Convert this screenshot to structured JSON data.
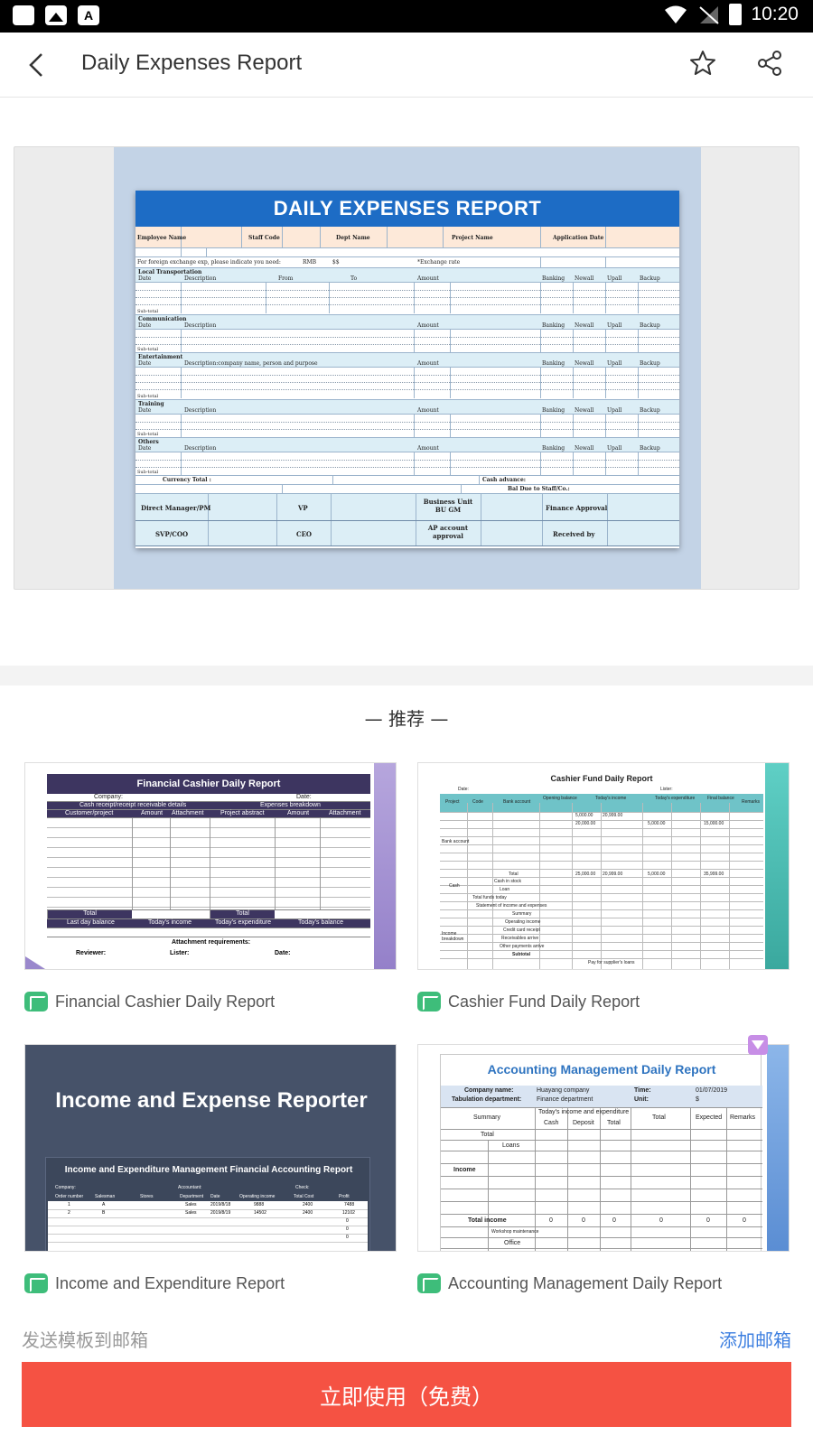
{
  "status_bar": {
    "time": "10:20"
  },
  "app_bar": {
    "title": "Daily Expenses Report"
  },
  "preview": {
    "doc_title": "DAILY EXPENSES REPORT",
    "header_fields": [
      "Employee Name",
      "Staff Code",
      "Dept Name",
      "Project Name",
      "Application Date"
    ],
    "exchange_note": "For foreign exchange exp, please indicate you need:",
    "rmb": "RMB",
    "usd": "$$",
    "exchange_rate": "*Exchange rate",
    "sections": [
      "Local Transportation",
      "Communication",
      "Entertainment",
      "Training",
      "Others"
    ],
    "col_date": "Date",
    "col_desc": "Description",
    "col_desc_ent": "Description:company name, person and purpose",
    "col_from": "From",
    "col_to": "To",
    "col_amount": "Amount",
    "col_banking": "Banking",
    "col_newall": "Newall",
    "col_upall": "Upall",
    "col_backup": "Backup",
    "subtotal": "Sub-total",
    "currency_total": "Currency Total :",
    "cash_advance": "Cash advance:",
    "bal_due": "Bal Due to Staff/Co.:",
    "approvals": [
      "Direct Manager/PM",
      "VP",
      "Business Unit BU GM",
      "Finance Approval",
      "SVP/COO",
      "CEO",
      "AP account approval",
      "Received by"
    ]
  },
  "recommend": {
    "heading": "— 推荐 —",
    "cards": [
      {
        "label": "Financial Cashier Daily Report"
      },
      {
        "label": "Cashier Fund Daily Report"
      },
      {
        "label": "Income and Expenditure Report"
      },
      {
        "label": "Accounting Management Daily Report"
      }
    ]
  },
  "thumb1": {
    "title": "Financial Cashier Daily Report",
    "company": "Company:",
    "date": "Date:",
    "receipt": "Cash receipt/receipt receivable details",
    "breakdown": "Expenses breakdown",
    "cols": [
      "Customer/project",
      "Amount",
      "Attachment",
      "Project abstract",
      "Amount",
      "Attachment"
    ],
    "total": "Total",
    "total2": "Total",
    "balances": [
      "Last day balance",
      "Today's income",
      "Today's expenditure",
      "Today's balance"
    ],
    "attach_req": "Attachment requirements:",
    "reviewer": "Reviewer:",
    "lister": "Lister:",
    "date2": "Date:"
  },
  "thumb2": {
    "title": "Cashier Fund Daily Report",
    "date": "Date:",
    "lister": "Lister:",
    "cols": [
      "Project",
      "Code",
      "Bank account",
      "Opening balance",
      "Today's income",
      "Today's expenditure",
      "Final balance",
      "Remarks"
    ],
    "rows": [
      "Bank account",
      "Total",
      "Cash",
      "Cash in stock",
      "Loan",
      "Total funds today",
      "Statement of income and expenses",
      "Summary",
      "Operating income",
      "Credit card receipt",
      "Receivables arrive",
      "Other payments arrive",
      "Income breakdown",
      "Subtotal",
      "Pay for supplier's loans"
    ],
    "values": [
      "5,000.00",
      "20,999.00",
      "20,000.00",
      "5,000.00",
      "15,000.00",
      "25,000.00",
      "20,999.00",
      "5,000.00",
      "35,999.00"
    ]
  },
  "thumb3": {
    "title": "Income and Expense Reporter",
    "box_title": "Income and Expenditure Management Financial Accounting Report",
    "company": "Company:",
    "accountant": "Accountant:",
    "check": "Check:",
    "cols": [
      "Order number",
      "Salesman",
      "Stores",
      "Department",
      "Date",
      "Operating income",
      "Total Cost",
      "Profit"
    ],
    "rows": [
      [
        "1",
        "A",
        "",
        "Sales",
        "2019/8/18",
        "9888",
        "2400",
        "7488"
      ],
      [
        "2",
        "B",
        "",
        "Sales",
        "2019/8/19",
        "14502",
        "2400",
        "12102"
      ]
    ],
    "zeros": [
      "0",
      "0",
      "0"
    ]
  },
  "thumb4": {
    "title": "Accounting Management Daily Report",
    "company_name": "Company name:",
    "company_val": "Huayang company",
    "time": "Time:",
    "time_val": "01/07/2019",
    "tab_dept": "Tabulation department:",
    "tab_dept_val": "Finance department",
    "unit": "Unit:",
    "unit_val": "$",
    "summary": "Summary",
    "today": "Today's income and expenditure",
    "cash": "Cash",
    "deposit": "Deposit",
    "total": "Total",
    "total_col": "Total",
    "expected": "Expected",
    "remarks": "Remarks",
    "total_row": "Total",
    "loans": "Loans",
    "income": "Income",
    "total_income": "Total income",
    "zeros": [
      "0",
      "0",
      "0",
      "0",
      "0",
      "0"
    ],
    "workshop": "Workshop maintenance",
    "office": "Office"
  },
  "bottom": {
    "send_label": "发送模板到邮箱",
    "add_mail": "添加邮箱",
    "use_button": "立即使用（免费）"
  }
}
